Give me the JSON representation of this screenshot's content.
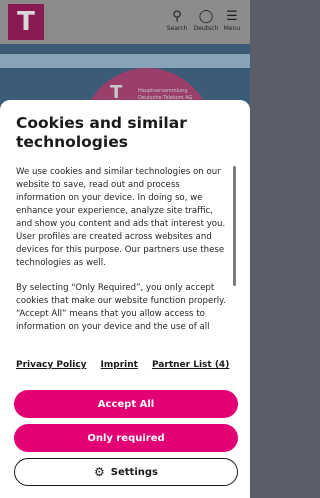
{
  "header": {
    "logo": "T",
    "search_label": "Search",
    "language_label": "Deutsch",
    "menu_label": "Menu"
  },
  "background": {
    "logo": "T",
    "text": "Hauptversammlung Deutsche Telekom AG"
  },
  "dialog": {
    "title": "Cookies and similar technologies",
    "paragraph1": "We use cookies and similar technologies on our website to save, read out and process information on your device. In doing so, we enhance your experience, analyze site traffic, and show you content and ads that interest you. User profiles are created across websites and devices for this purpose. Our partners use these technologies as well.",
    "paragraph2": "By selecting “Only Required”, you only accept cookies that make our website function properly. “Accept All” means that you allow access to information on your device and the use of all",
    "links": {
      "privacy": "Privacy Policy",
      "imprint": "Imprint",
      "partners": "Partner List (4)"
    },
    "buttons": {
      "accept_all": "Accept All",
      "only_required": "Only required",
      "settings": "Settings"
    }
  },
  "colors": {
    "brand": "#e20074"
  }
}
